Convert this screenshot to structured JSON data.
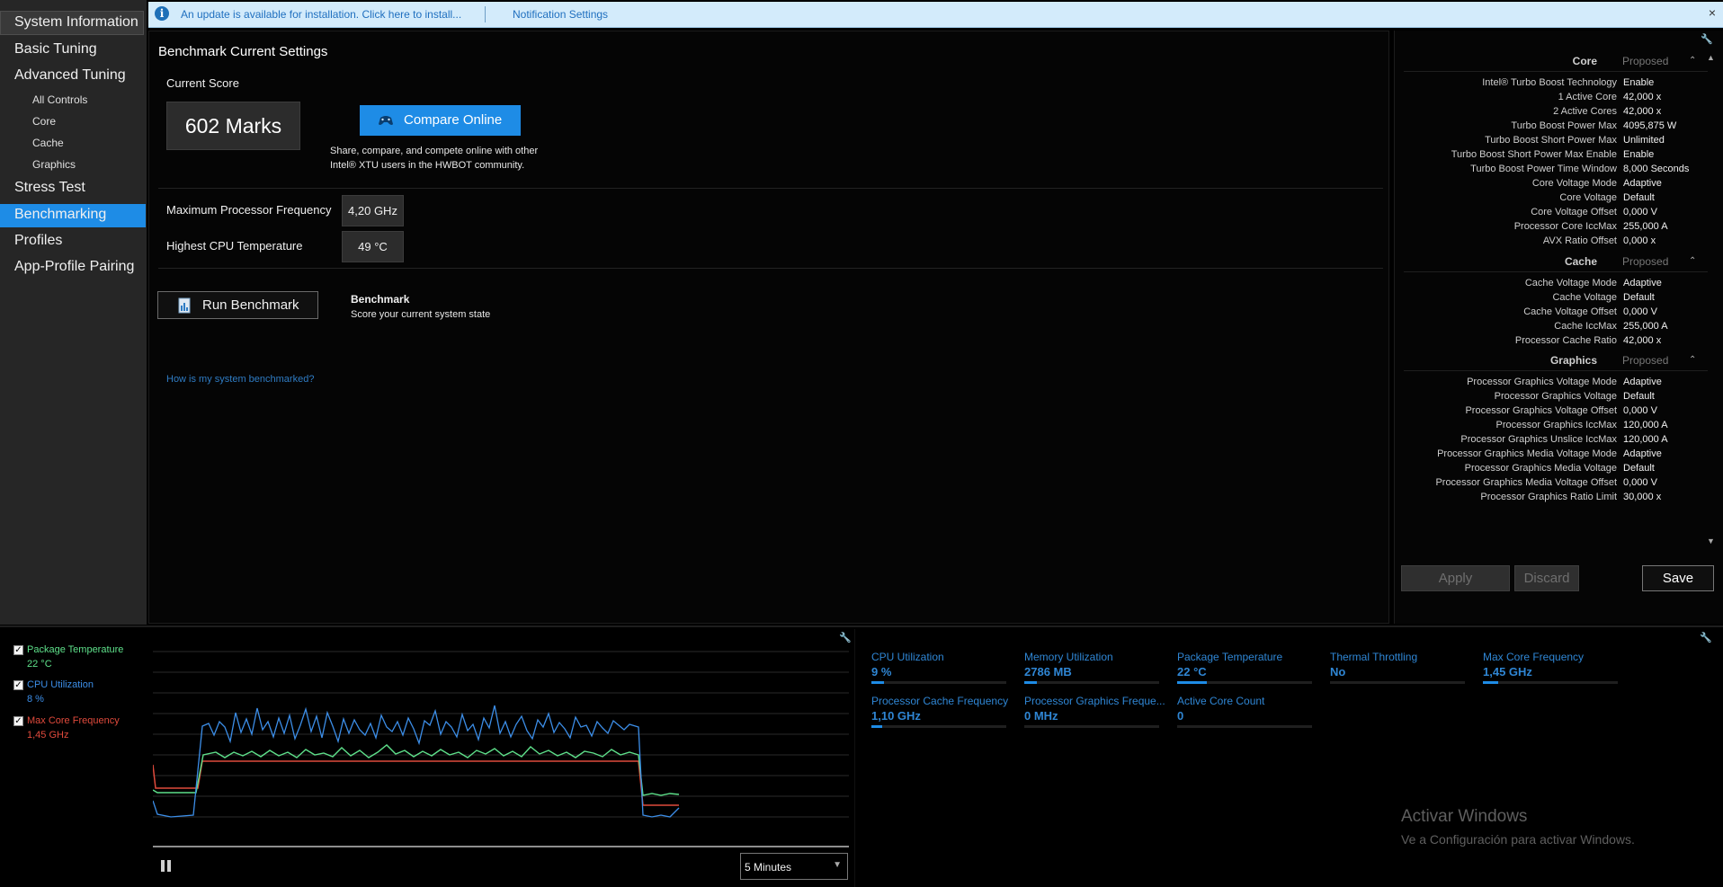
{
  "sidebar": {
    "items": [
      {
        "label": "System Information"
      },
      {
        "label": "Basic Tuning"
      },
      {
        "label": "Advanced Tuning"
      },
      {
        "label": "All Controls"
      },
      {
        "label": "Core"
      },
      {
        "label": "Cache"
      },
      {
        "label": "Graphics"
      },
      {
        "label": "Stress Test"
      },
      {
        "label": "Benchmarking",
        "active": true
      },
      {
        "label": "Profiles"
      },
      {
        "label": "App-Profile Pairing"
      }
    ]
  },
  "notification": {
    "message": "An update is available for installation. Click here to install...",
    "settings_link": "Notification Settings",
    "close": "×"
  },
  "main": {
    "title": "Benchmark Current Settings",
    "current_score_label": "Current Score",
    "score": "602 Marks",
    "compare_button": "Compare Online",
    "compare_desc_1": "Share, compare, and compete online with other",
    "compare_desc_2": "Intel® XTU users in the HWBOT community.",
    "max_freq_label": "Maximum Processor Frequency",
    "max_freq_value": "4,20 GHz",
    "max_temp_label": "Highest CPU Temperature",
    "max_temp_value": "49 °C",
    "run_button": "Run Benchmark",
    "benchmark_title": "Benchmark",
    "benchmark_desc": "Score your current system state",
    "help_link": "How is my system benchmarked?"
  },
  "settings": {
    "proposed_label": "Proposed",
    "sections": [
      {
        "title": "Core",
        "rows": [
          {
            "name": "Intel® Turbo Boost Technology",
            "value": "Enable"
          },
          {
            "name": "1 Active Core",
            "value": "42,000 x"
          },
          {
            "name": "2 Active Cores",
            "value": "42,000 x"
          },
          {
            "name": "Turbo Boost Power Max",
            "value": "4095,875 W"
          },
          {
            "name": "Turbo Boost Short Power Max",
            "value": "Unlimited"
          },
          {
            "name": "Turbo Boost Short Power Max Enable",
            "value": "Enable"
          },
          {
            "name": "Turbo Boost Power Time Window",
            "value": "8,000 Seconds"
          },
          {
            "name": "Core Voltage Mode",
            "value": "Adaptive"
          },
          {
            "name": "Core Voltage",
            "value": "Default"
          },
          {
            "name": "Core Voltage Offset",
            "value": "0,000 V"
          },
          {
            "name": "Processor Core IccMax",
            "value": "255,000 A"
          },
          {
            "name": "AVX Ratio Offset",
            "value": "0,000 x"
          }
        ]
      },
      {
        "title": "Cache",
        "rows": [
          {
            "name": "Cache Voltage Mode",
            "value": "Adaptive"
          },
          {
            "name": "Cache Voltage",
            "value": "Default"
          },
          {
            "name": "Cache Voltage Offset",
            "value": "0,000 V"
          },
          {
            "name": "Cache IccMax",
            "value": "255,000 A"
          },
          {
            "name": "Processor Cache Ratio",
            "value": "42,000 x"
          }
        ]
      },
      {
        "title": "Graphics",
        "rows": [
          {
            "name": "Processor Graphics Voltage Mode",
            "value": "Adaptive"
          },
          {
            "name": "Processor Graphics Voltage",
            "value": "Default"
          },
          {
            "name": "Processor Graphics Voltage Offset",
            "value": "0,000 V"
          },
          {
            "name": "Processor Graphics IccMax",
            "value": "120,000 A"
          },
          {
            "name": "Processor Graphics Unslice IccMax",
            "value": "120,000 A"
          },
          {
            "name": "Processor Graphics Media Voltage Mode",
            "value": "Adaptive"
          },
          {
            "name": "Processor Graphics Media Voltage",
            "value": "Default"
          },
          {
            "name": "Processor Graphics Media Voltage Offset",
            "value": "0,000 V"
          },
          {
            "name": "Processor Graphics Ratio Limit",
            "value": "30,000 x"
          }
        ]
      }
    ],
    "apply": "Apply",
    "discard": "Discard",
    "save": "Save"
  },
  "monitor": {
    "legend": [
      {
        "label": "Package Temperature",
        "value": "22 °C",
        "color": "#5ee08a",
        "checked": true
      },
      {
        "label": "CPU Utilization",
        "value": "8 %",
        "color": "#3c8ee8",
        "checked": true
      },
      {
        "label": "Max Core Frequency",
        "value": "1,45 GHz",
        "color": "#e04a3c",
        "checked": true
      }
    ],
    "time_range": "5 Minutes",
    "metrics": [
      {
        "label": "CPU Utilization",
        "value": "9 %",
        "fill": 0.09
      },
      {
        "label": "Memory Utilization",
        "value": "2786  MB",
        "fill": 0.09
      },
      {
        "label": "Package Temperature",
        "value": "22 °C",
        "fill": 0.22
      },
      {
        "label": "Thermal Throttling",
        "value": "No",
        "fill": 0
      },
      {
        "label": "Max Core Frequency",
        "value": "1,45 GHz",
        "fill": 0.11
      },
      {
        "label": "Processor Cache Frequency",
        "value": "1,10 GHz",
        "fill": 0.08
      },
      {
        "label": "Processor Graphics Freque...",
        "value": "0 MHz",
        "fill": 0
      },
      {
        "label": "Active Core Count",
        "value": "0",
        "fill": 0
      }
    ]
  },
  "watermark": {
    "line1": "Activar Windows",
    "line2": "Ve a Configuración para activar Windows."
  }
}
